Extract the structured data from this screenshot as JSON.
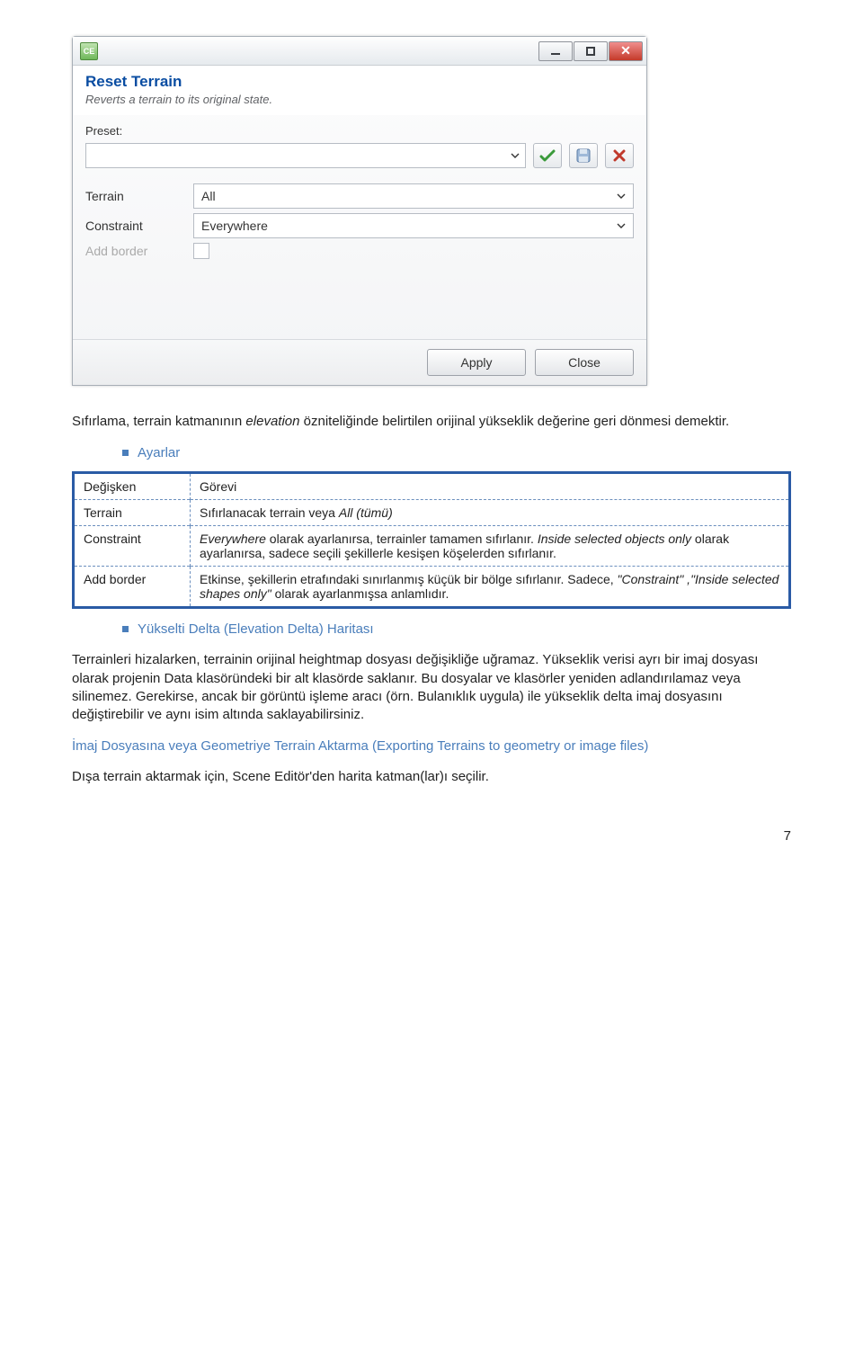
{
  "dialog": {
    "icon_text": "CE",
    "title": "Reset Terrain",
    "subtitle": "Reverts a terrain to its original state.",
    "preset_label": "Preset:",
    "preset_value": "",
    "rows": {
      "terrain_label": "Terrain",
      "terrain_value": "All",
      "constraint_label": "Constraint",
      "constraint_value": "Everywhere",
      "addborder_label": "Add border"
    },
    "apply": "Apply",
    "close": "Close"
  },
  "intro": {
    "prefix": "Sıfırlama, terrain katmanının ",
    "em": "elevation",
    "suffix": " özniteliğinde belirtilen orijinal yükseklik değerine geri dönmesi demektir."
  },
  "ayarlar_label": "Ayarlar",
  "table": {
    "h1": "Değişken",
    "h2": "Görevi",
    "r1c1": "Terrain",
    "r1c2_a": "Sıfırlanacak terrain veya ",
    "r1c2_b": "All (tümü)",
    "r2c1": "Constraint",
    "r2c2_a": "Everywhere",
    "r2c2_b": " olarak ayarlanırsa, terrainler tamamen sıfırlanır. ",
    "r2c2_c": "Inside selected objects only",
    "r2c2_d": " olarak ayarlanırsa, sadece seçili şekillerle kesişen köşelerden sıfırlanır.",
    "r3c1": "Add border",
    "r3c2_a": "Etkinse, şekillerin etrafındaki sınırlanmış küçük bir bölge sıfırlanır. Sadece, ",
    "r3c2_b": "\"Constraint\" ,\"Inside selected shapes only\"",
    "r3c2_c": " olarak ayarlanmışsa anlamlıdır."
  },
  "delta_heading": "Yükselti Delta (Elevation Delta) Haritası",
  "delta_para": "Terrainleri hizalarken, terrainin orijinal heightmap dosyası değişikliğe uğramaz. Yükseklik verisi ayrı bir imaj dosyası olarak projenin Data klasöründeki bir alt klasörde saklanır. Bu dosyalar ve klasörler yeniden adlandırılamaz veya silinemez. Gerekirse, ancak bir görüntü işleme aracı (örn. Bulanıklık uygula) ile yükseklik delta imaj dosyasını değiştirebilir ve aynı isim altında saklayabilirsiniz.",
  "export_heading": "İmaj Dosyasına veya Geometriye Terrain Aktarma (Exporting Terrains to geometry or image files)",
  "export_para": "Dışa terrain aktarmak için, Scene Editör'den harita katman(lar)ı seçilir.",
  "page_number": "7"
}
